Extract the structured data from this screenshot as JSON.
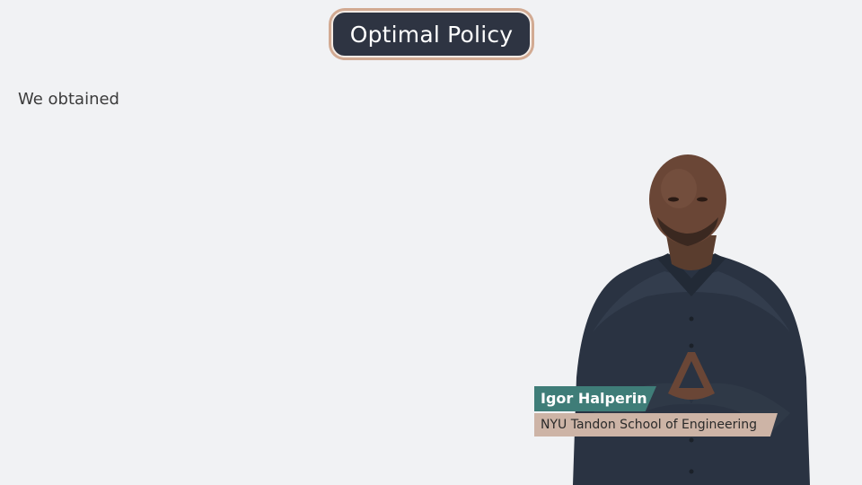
{
  "slide": {
    "title": "Optimal Policy",
    "intro_text": "We obtained"
  },
  "presenter": {
    "name": "Igor Halperin",
    "affiliation": "NYU Tandon School of Engineering"
  },
  "colors": {
    "background": "#f1f2f4",
    "title_pill_fill": "#2e3442",
    "title_pill_border": "#d2aa92",
    "name_bar": "#3f7d78",
    "affiliation_bar": "#cdb4a6"
  }
}
